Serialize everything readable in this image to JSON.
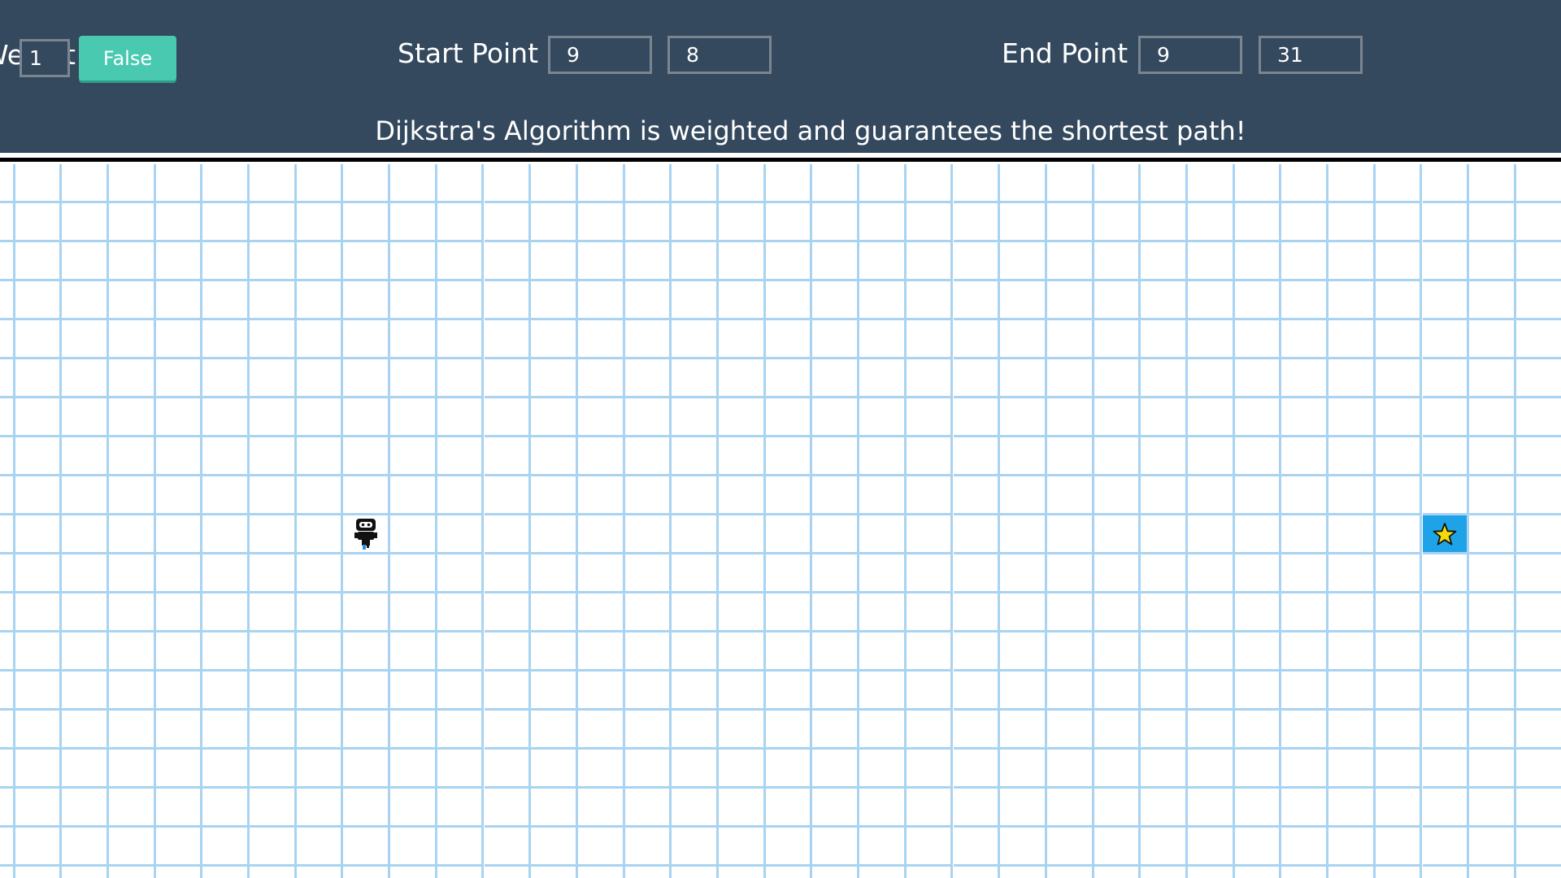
{
  "header": {
    "weight_label": "Weight",
    "weight_value": "1",
    "toggle_label": "False",
    "start_label": "Start Point :",
    "start_row": "9",
    "start_col": "8",
    "end_label": "End Point :",
    "end_row": "9",
    "end_col": "31",
    "description": "Dijkstra's Algorithm is weighted and guarantees the shortest path!"
  },
  "grid": {
    "start": {
      "row": 9,
      "col": 8,
      "icon": "robot-icon"
    },
    "end": {
      "row": 9,
      "col": 31,
      "icon": "star-icon"
    }
  },
  "colors": {
    "header_bg": "#34495e",
    "button": "#48c9b0",
    "grid_line": "#a9d3f2",
    "end_cell": "#1fa3e8",
    "star": "#f5d90a"
  }
}
